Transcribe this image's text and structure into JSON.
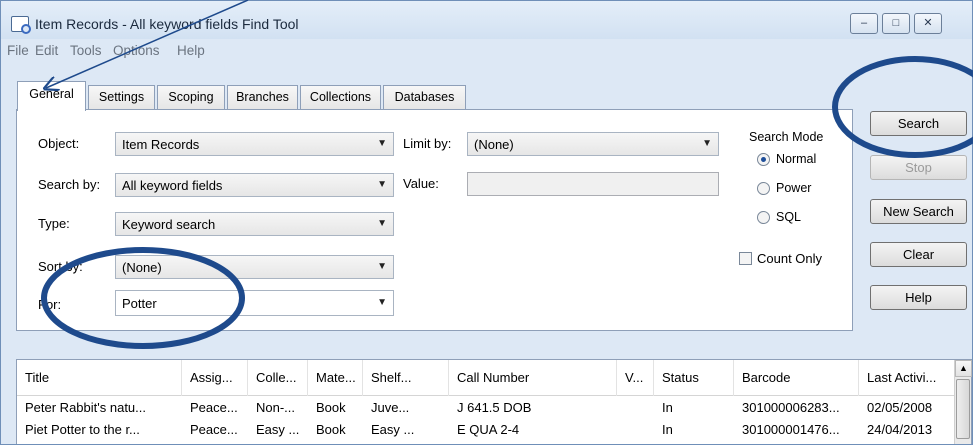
{
  "window": {
    "title": "Item Records - All keyword fields Find Tool",
    "minimize": "–",
    "maximize": "□",
    "close": "✕"
  },
  "menu": [
    "File",
    "Edit",
    "Tools",
    "Options",
    "Help"
  ],
  "tabs": [
    "General",
    "Settings",
    "Scoping",
    "Branches",
    "Collections",
    "Databases"
  ],
  "form": {
    "object_label": "Object:",
    "object_value": "Item Records",
    "searchby_label": "Search by:",
    "searchby_value": "All keyword fields",
    "type_label": "Type:",
    "type_value": "Keyword search",
    "sortby_label": "Sort by:",
    "sortby_value": "(None)",
    "for_label": "For:",
    "for_value": "Potter",
    "limitby_label": "Limit by:",
    "limitby_value": "(None)",
    "value_label": "Value:",
    "value_value": ""
  },
  "search_mode": {
    "title": "Search Mode",
    "options": [
      "Normal",
      "Power",
      "SQL"
    ],
    "selected": "Normal"
  },
  "count_only": "Count Only",
  "buttons": {
    "search": "Search",
    "stop": "Stop",
    "new_search": "New Search",
    "clear": "Clear",
    "help": "Help"
  },
  "results": {
    "columns": [
      "Title",
      "Assig...",
      "Colle...",
      "Mate...",
      "Shelf...",
      "Call Number",
      "V...",
      "Status",
      "Barcode",
      "Last Activi..."
    ],
    "rows": [
      [
        "Peter Rabbit's natu...",
        "Peace...",
        "Non-...",
        "Book",
        "Juve...",
        "J 641.5 DOB",
        "",
        "In",
        "301000006283...",
        "02/05/2008"
      ],
      [
        "Piet Potter to the r...",
        "Peace...",
        "Easy ...",
        "Book",
        "Easy ...",
        "E QUA 2-4",
        "",
        "In",
        "301000001476...",
        "24/04/2013"
      ]
    ]
  },
  "colors": {
    "annotation": "#1e4a8c",
    "titlebar": "#dde8f5"
  }
}
